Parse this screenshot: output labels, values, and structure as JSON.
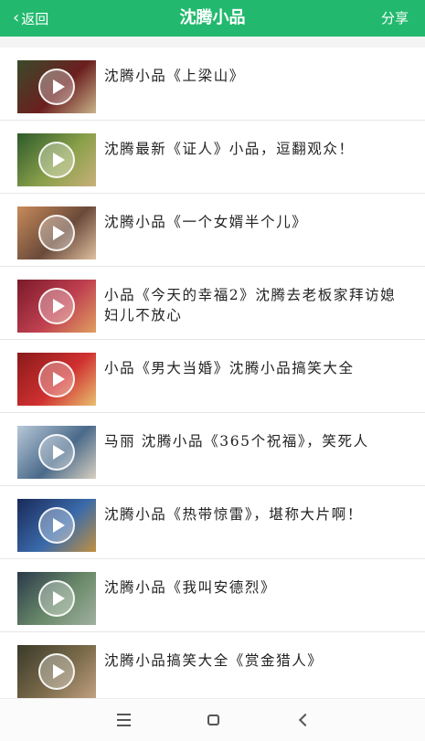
{
  "header": {
    "back_label": "返回",
    "title": "沈腾小品",
    "share_label": "分享",
    "bg_color": "#22b96e"
  },
  "items": [
    {
      "title": "沈腾小品《上梁山》",
      "thumb_colors": [
        "#3a4a2a",
        "#6b1f1f",
        "#c9b38a"
      ]
    },
    {
      "title": "沈腾最新《证人》小品，逗翻观众！",
      "thumb_colors": [
        "#2d5a2a",
        "#8aa04a",
        "#c8b07a"
      ]
    },
    {
      "title": "沈腾小品《一个女婿半个儿》",
      "thumb_colors": [
        "#c88a5a",
        "#6a4a3a",
        "#e0c0a0"
      ]
    },
    {
      "title": "小品《今天的幸福2》沈腾去老板家拜访媳妇儿不放心",
      "thumb_colors": [
        "#7a1a2a",
        "#c04050",
        "#e0a060"
      ]
    },
    {
      "title": "小品《男大当婚》沈腾小品搞笑大全",
      "thumb_colors": [
        "#8a1a1a",
        "#d03030",
        "#e8c070"
      ]
    },
    {
      "title": "马丽 沈腾小品《365个祝福》，笑死人",
      "thumb_colors": [
        "#b8c8d8",
        "#4a6a8a",
        "#d8d0c0"
      ]
    },
    {
      "title": "沈腾小品《热带惊雷》，堪称大片啊！",
      "thumb_colors": [
        "#1a2a5a",
        "#3a6aaa",
        "#c09040"
      ]
    },
    {
      "title": "沈腾小品《我叫安德烈》",
      "thumb_colors": [
        "#2a3a4a",
        "#6a8a6a",
        "#a0b0a0"
      ]
    },
    {
      "title": "沈腾小品搞笑大全《赏金猎人》",
      "thumb_colors": [
        "#3a3a2a",
        "#7a6a4a",
        "#c0a080"
      ]
    }
  ],
  "navbar": {
    "menu_icon": "menu-icon",
    "home_icon": "home-icon",
    "back_icon": "back-icon"
  }
}
